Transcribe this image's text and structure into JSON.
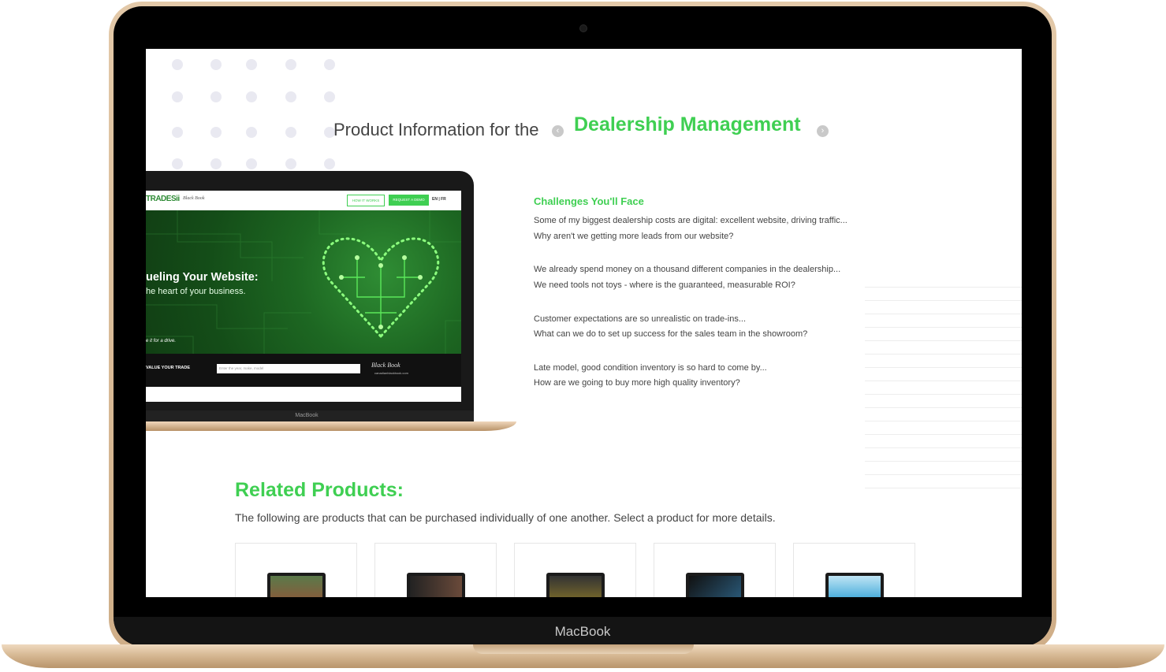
{
  "device": {
    "brand_label": "MacBook"
  },
  "page": {
    "title_prefix": "Product Information for the",
    "title_product": "Dealership Management",
    "prev_arrow": "‹",
    "next_arrow": "›"
  },
  "preview": {
    "logo": "TRADESii",
    "partner_logo": "Black Book",
    "nav_how": "HOW IT WORKS",
    "nav_demo": "REQUEST A DEMO",
    "nav_lang": "EN | FR",
    "hero_headline": "ueling Your Website:",
    "hero_sub": "he heart of your business.",
    "hero_note": "e it for a drive.",
    "form_label": "VALUE YOUR TRADE",
    "form_placeholder": "Enter the year, make, model",
    "form_partner": "Black Book",
    "form_partner_site": "canadianblackbook.com",
    "device_label": "MacBook"
  },
  "challenges": {
    "title": "Challenges You'll Face",
    "groups": [
      {
        "line1": "Some of my biggest dealership costs are digital: excellent website, driving traffic...",
        "line2": "Why aren't we getting more leads from our website?"
      },
      {
        "line1": "We already spend money on a thousand different companies in the dealership...",
        "line2": "We need tools not toys - where is the guaranteed, measurable ROI?"
      },
      {
        "line1": "Customer expectations are so unrealistic on trade-ins...",
        "line2": "What can we do to set up success for the sales team in the showroom?"
      },
      {
        "line1": "Late model, good condition inventory is so hard to come by...",
        "line2": "How are we going to buy more high quality inventory?"
      }
    ]
  },
  "related": {
    "title": "Related Products:",
    "description": "The following are products that can be purchased individually of one another. Select a product for more details."
  },
  "colors": {
    "accent": "#3fcf52",
    "text": "#444444",
    "hero": "#1d6722"
  }
}
